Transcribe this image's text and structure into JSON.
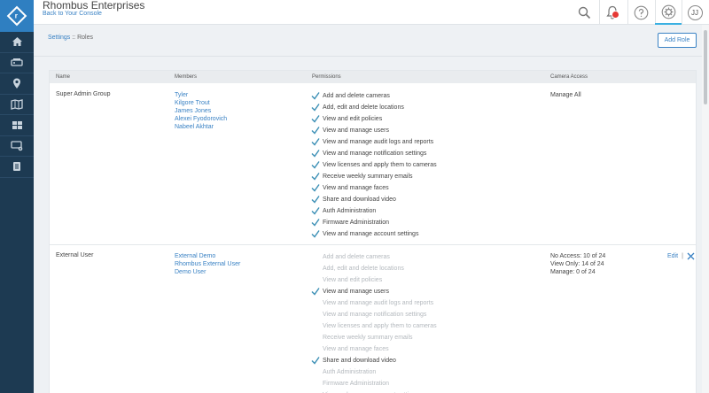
{
  "header": {
    "org_name": "Rhombus Enterprises",
    "back_link": "Back to Your Console",
    "notification_badge_color": "#e53935",
    "user_initials": "JJ",
    "accent": "#3a82c4"
  },
  "sidebar": {
    "logo": "r",
    "items": [
      {
        "icon": "home-icon"
      },
      {
        "icon": "camera-devices-icon"
      },
      {
        "icon": "location-pin-icon"
      },
      {
        "icon": "map-icon"
      },
      {
        "icon": "video-wall-icon"
      },
      {
        "icon": "device-settings-icon"
      },
      {
        "icon": "report-document-icon"
      }
    ]
  },
  "breadcrumb": {
    "parent": "Settings",
    "separator": " :: ",
    "current": "Roles"
  },
  "add_role_label": "Add Role",
  "table": {
    "columns": [
      "Name",
      "Members",
      "Permissions",
      "Camera Access"
    ],
    "rows": [
      {
        "name": "Super Admin Group",
        "members": [
          "Tyler",
          "Kilgore Trout",
          "James Jones",
          "Alexei Fyodorovich",
          "Nabeel Akhtar"
        ],
        "permissions": [
          {
            "label": "Add and delete cameras",
            "enabled": true
          },
          {
            "label": "Add, edit and delete locations",
            "enabled": true
          },
          {
            "label": "View and edit policies",
            "enabled": true
          },
          {
            "label": "View and manage users",
            "enabled": true
          },
          {
            "label": "View and manage audit logs and reports",
            "enabled": true
          },
          {
            "label": "View and manage notification settings",
            "enabled": true
          },
          {
            "label": "View licenses and apply them to cameras",
            "enabled": true
          },
          {
            "label": "Receive weekly summary emails",
            "enabled": true
          },
          {
            "label": "View and manage faces",
            "enabled": true
          },
          {
            "label": "Share and download video",
            "enabled": true
          },
          {
            "label": "Auth Administration",
            "enabled": true
          },
          {
            "label": "Firmware Administration",
            "enabled": true
          },
          {
            "label": "View and manage account settings",
            "enabled": true
          }
        ],
        "camera_access": [
          "Manage All"
        ],
        "actions": null
      },
      {
        "name": "External User",
        "members": [
          "External Demo",
          "Rhombus External User",
          "Demo User"
        ],
        "permissions": [
          {
            "label": "Add and delete cameras",
            "enabled": false
          },
          {
            "label": "Add, edit and delete locations",
            "enabled": false
          },
          {
            "label": "View and edit policies",
            "enabled": false
          },
          {
            "label": "View and manage users",
            "enabled": true
          },
          {
            "label": "View and manage audit logs and reports",
            "enabled": false
          },
          {
            "label": "View and manage notification settings",
            "enabled": false
          },
          {
            "label": "View licenses and apply them to cameras",
            "enabled": false
          },
          {
            "label": "Receive weekly summary emails",
            "enabled": false
          },
          {
            "label": "View and manage faces",
            "enabled": false
          },
          {
            "label": "Share and download video",
            "enabled": true
          },
          {
            "label": "Auth Administration",
            "enabled": false
          },
          {
            "label": "Firmware Administration",
            "enabled": false
          },
          {
            "label": "View and manage account settings",
            "enabled": false
          }
        ],
        "camera_access": [
          "No Access: 10 of 24",
          "View Only: 14 of 24",
          "Manage: 0 of 24"
        ],
        "actions": {
          "edit": "Edit",
          "separator": "|"
        }
      }
    ]
  }
}
